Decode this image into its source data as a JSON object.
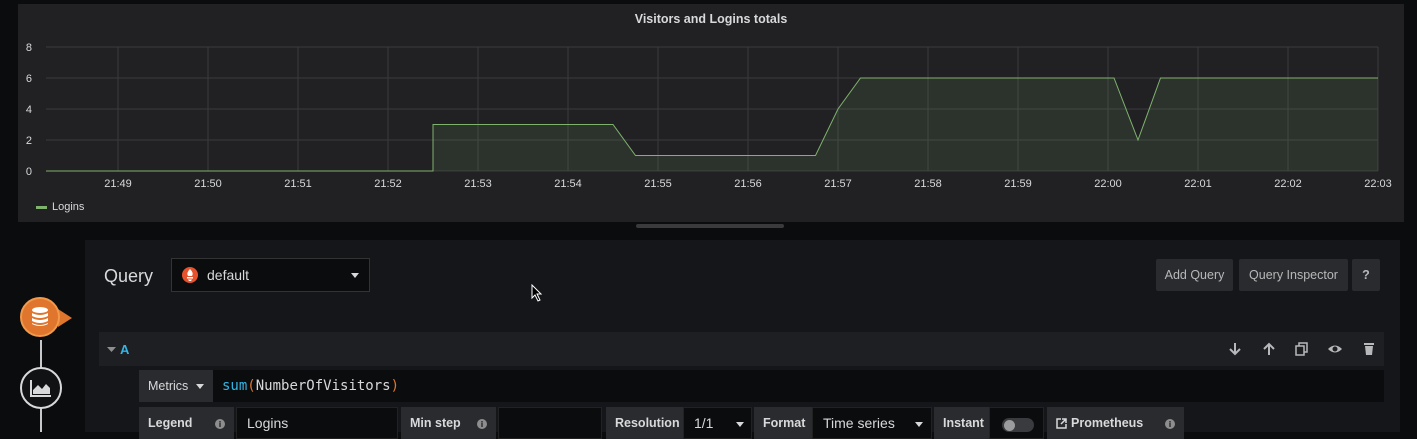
{
  "panel": {
    "title": "Visitors and Logins totals",
    "legend": [
      {
        "name": "Logins",
        "color": "#7eb26d"
      }
    ]
  },
  "chart_data": {
    "type": "area",
    "title": "Visitors and Logins totals",
    "xlabel": "",
    "ylabel": "",
    "x_ticks": [
      "21:49",
      "21:50",
      "21:51",
      "21:52",
      "21:53",
      "21:54",
      "21:55",
      "21:56",
      "21:57",
      "21:58",
      "21:59",
      "22:00",
      "22:01",
      "22:02",
      "22:03"
    ],
    "y_ticks": [
      0,
      2,
      4,
      6,
      8
    ],
    "ylim": [
      0,
      8
    ],
    "xlim": [
      "21:48:12",
      "22:03"
    ],
    "grid": true,
    "legend_position": "bottom-left",
    "series": [
      {
        "name": "Logins",
        "color": "#7eb26d",
        "points": [
          [
            "21:48:12",
            0
          ],
          [
            "21:52:30",
            0
          ],
          [
            "21:52:30",
            3
          ],
          [
            "21:54:30",
            3
          ],
          [
            "21:54:45",
            1
          ],
          [
            "21:56:45",
            1
          ],
          [
            "21:57:00",
            4
          ],
          [
            "21:57:15",
            6
          ],
          [
            "22:00:04",
            6
          ],
          [
            "22:00:20",
            2
          ],
          [
            "22:00:35",
            6
          ],
          [
            "22:03:00",
            6
          ]
        ]
      }
    ]
  },
  "editor": {
    "title": "Query",
    "datasource": "default",
    "add_query": "Add Query",
    "query_inspector": "Query Inspector",
    "help": "?"
  },
  "query_a": {
    "ref": "A",
    "metrics_label": "Metrics",
    "expr_fn": "sum",
    "expr_open": "(",
    "expr_arg": "NumberOfVisitors",
    "expr_close": ")",
    "legend_label": "Legend",
    "legend_value": "Logins",
    "min_step_label": "Min step",
    "min_step_value": "",
    "resolution_label": "Resolution",
    "resolution_value": "1/1",
    "format_label": "Format",
    "format_value": "Time series",
    "instant_label": "Instant",
    "instant_on": false,
    "prometheus_label": "Prometheus"
  }
}
